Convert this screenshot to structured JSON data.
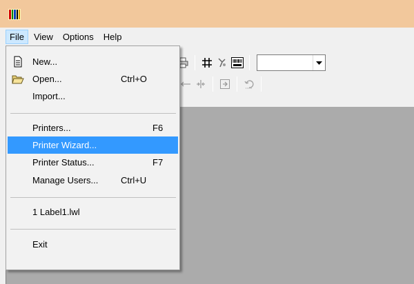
{
  "window": {
    "icon": "app-logo-icon",
    "title_bar_color": "#f2c89c"
  },
  "menubar": {
    "items": [
      {
        "label": "File"
      },
      {
        "label": "View"
      },
      {
        "label": "Options"
      },
      {
        "label": "Help"
      }
    ]
  },
  "file_menu": {
    "new": {
      "label": "New...",
      "shortcut": ""
    },
    "open": {
      "label": "Open...",
      "shortcut": "Ctrl+O"
    },
    "import": {
      "label": "Import...",
      "shortcut": ""
    },
    "printers": {
      "label": "Printers...",
      "shortcut": "F6"
    },
    "printer_wizard": {
      "label": "Printer Wizard...",
      "shortcut": ""
    },
    "printer_status": {
      "label": "Printer Status...",
      "shortcut": "F7"
    },
    "manage_users": {
      "label": "Manage Users...",
      "shortcut": "Ctrl+U"
    },
    "recent_1": {
      "label": "1 Label1.lwl",
      "shortcut": ""
    },
    "exit": {
      "label": "Exit",
      "shortcut": ""
    }
  },
  "toolbar": {
    "icons": [
      "print-icon",
      "grid-icon",
      "wizard-icon",
      "barcode-odp-icon",
      "align-center-icon",
      "split-icon",
      "rotate-icon",
      "undo-icon"
    ],
    "combo_value": ""
  },
  "colors": {
    "highlight": "#3399ff",
    "workspace": "#ababab",
    "menu_open": "#cce8ff"
  }
}
